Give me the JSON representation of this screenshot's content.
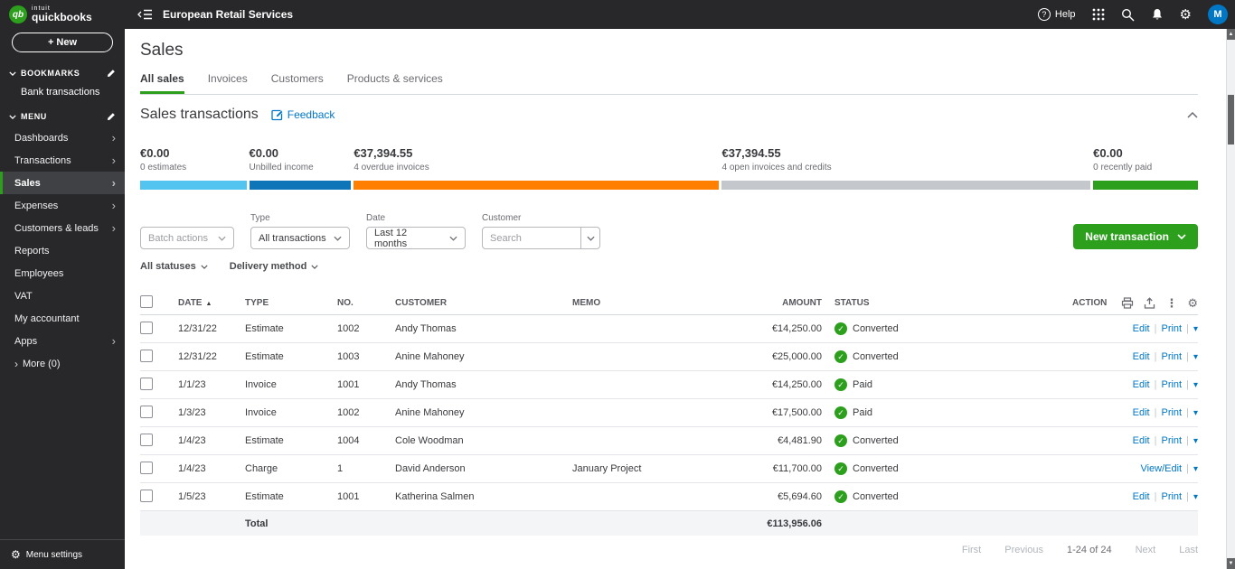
{
  "topbar": {
    "company": "European Retail Services",
    "help_label": "Help",
    "avatar_initial": "M"
  },
  "sidebar": {
    "logo": {
      "badge": "qb",
      "intuit": "intuit",
      "quickbooks": "quickbooks"
    },
    "new_button": "+ New",
    "bookmarks_label": "BOOKMARKS",
    "bookmarks": [
      {
        "label": "Bank transactions"
      }
    ],
    "menu_label": "MENU",
    "menu": [
      {
        "label": "Dashboards",
        "chevron": true
      },
      {
        "label": "Transactions",
        "chevron": true
      },
      {
        "label": "Sales",
        "chevron": true,
        "active": true
      },
      {
        "label": "Expenses",
        "chevron": true
      },
      {
        "label": "Customers & leads",
        "chevron": true
      },
      {
        "label": "Reports"
      },
      {
        "label": "Employees"
      },
      {
        "label": "VAT"
      },
      {
        "label": "My accountant"
      },
      {
        "label": "Apps",
        "chevron": true
      },
      {
        "label": "More (0)",
        "leading_chevron": true
      }
    ],
    "menu_settings": "Menu settings"
  },
  "page": {
    "title": "Sales",
    "tabs": [
      "All sales",
      "Invoices",
      "Customers",
      "Products & services"
    ],
    "active_tab": "All sales"
  },
  "card": {
    "title": "Sales transactions",
    "feedback_label": "Feedback",
    "accent_green": "#2ca01c"
  },
  "money_bar": {
    "segments": [
      {
        "amount": "€0.00",
        "label": "0 estimates",
        "color": "#53c4ef",
        "width_pct": 10.3
      },
      {
        "amount": "€0.00",
        "label": "Unbilled income",
        "color": "#0d75b8",
        "width_pct": 9.9
      },
      {
        "amount": "€37,394.55",
        "label": "4 overdue invoices",
        "color": "#ff8000",
        "width_pct": 34.8
      },
      {
        "amount": "€37,394.55",
        "label": "4 open invoices and credits",
        "color": "#c4c7cc",
        "width_pct": 35.1
      },
      {
        "amount": "€0.00",
        "label": "0 recently paid",
        "color": "#2ca01c",
        "width_pct": 9.9
      }
    ]
  },
  "filters": {
    "batch_actions_label": "Batch actions",
    "type_label": "Type",
    "type_value": "All transactions",
    "date_label": "Date",
    "date_value": "Last 12 months",
    "customer_label": "Customer",
    "customer_placeholder": "Search",
    "statuses_label": "All statuses",
    "delivery_label": "Delivery method",
    "new_transaction_label": "New transaction"
  },
  "table": {
    "headers": [
      "DATE",
      "TYPE",
      "NO.",
      "CUSTOMER",
      "MEMO",
      "AMOUNT",
      "STATUS",
      "ACTION"
    ],
    "sort_indicator": "▲",
    "rows": [
      {
        "date": "12/31/22",
        "type": "Estimate",
        "no": "1002",
        "customer": "Andy Thomas",
        "memo": "",
        "amount": "€14,250.00",
        "status": "Converted",
        "actions": [
          "Edit",
          "Print"
        ]
      },
      {
        "date": "12/31/22",
        "type": "Estimate",
        "no": "1003",
        "customer": "Anine Mahoney",
        "memo": "",
        "amount": "€25,000.00",
        "status": "Converted",
        "actions": [
          "Edit",
          "Print"
        ]
      },
      {
        "date": "1/1/23",
        "type": "Invoice",
        "no": "1001",
        "customer": "Andy Thomas",
        "memo": "",
        "amount": "€14,250.00",
        "status": "Paid",
        "actions": [
          "Edit",
          "Print"
        ]
      },
      {
        "date": "1/3/23",
        "type": "Invoice",
        "no": "1002",
        "customer": "Anine Mahoney",
        "memo": "",
        "amount": "€17,500.00",
        "status": "Paid",
        "actions": [
          "Edit",
          "Print"
        ]
      },
      {
        "date": "1/4/23",
        "type": "Estimate",
        "no": "1004",
        "customer": "Cole Woodman",
        "memo": "",
        "amount": "€4,481.90",
        "status": "Converted",
        "actions": [
          "Edit",
          "Print"
        ]
      },
      {
        "date": "1/4/23",
        "type": "Charge",
        "no": "1",
        "customer": "David Anderson",
        "memo": "January Project",
        "amount": "€11,700.00",
        "status": "Converted",
        "actions": [
          "View/Edit"
        ]
      },
      {
        "date": "1/5/23",
        "type": "Estimate",
        "no": "1001",
        "customer": "Katherina Salmen",
        "memo": "",
        "amount": "€5,694.60",
        "status": "Converted",
        "actions": [
          "Edit",
          "Print"
        ]
      }
    ],
    "total_label": "Total",
    "total_amount": "€113,956.06"
  },
  "pagination": {
    "first": "First",
    "previous": "Previous",
    "range": "1-24 of 24",
    "next": "Next",
    "last": "Last"
  }
}
